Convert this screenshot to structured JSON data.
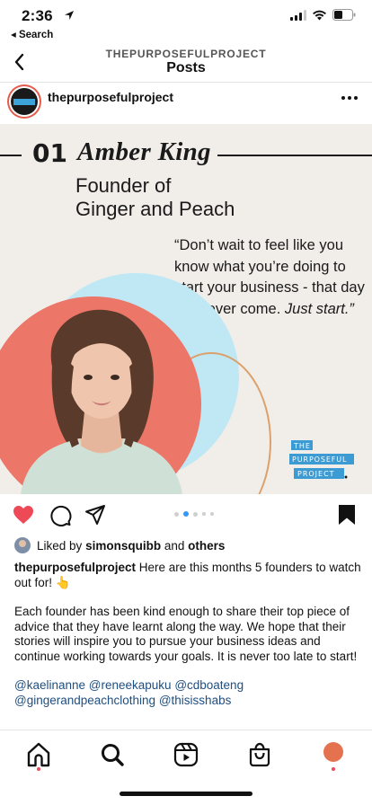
{
  "status_bar": {
    "time": "2:36",
    "back_app_label": "◂ Search"
  },
  "header": {
    "subtitle": "THEPURPOSEFULPROJECT",
    "title": "Posts"
  },
  "post": {
    "author": "thepurposefulproject",
    "image": {
      "number": "01",
      "name": "Amber King",
      "role_line1": "Founder of",
      "role_line2": "Ginger and Peach",
      "quote_main": "“Don’t wait to feel like you know what you’re doing to start your business - that day will never come.",
      "quote_emphasis": "Just start.”",
      "logo_line1": "THE",
      "logo_line2": "PURPOSEFUL",
      "logo_line3": "PROJECT",
      "colors": {
        "background": "#f1eee9",
        "red_circle": "#ec7668",
        "blue_circle": "#bfe8f4",
        "outline_circle": "#dca06c",
        "logo_blue": "#3d9bd3"
      }
    },
    "carousel": {
      "count": 5,
      "active_index": 1
    },
    "likes": {
      "prefix": "Liked by",
      "user": "simonsquibb",
      "joiner": "and",
      "others": "others"
    },
    "caption": {
      "author": "thepurposefulproject",
      "intro": "Here are this months 5 founders to watch out for! 👆",
      "body": "Each founder has been kind enough to share their top piece of advice that they have learnt along the way. We hope that their stories will inspire you to pursue your business ideas and continue working towards your goals. It is never too late to start!",
      "mentions": [
        "@kaelinanne",
        "@reneekapuku",
        "@cdboateng",
        "@gingerandpeachclothing",
        "@thisisshabs"
      ]
    }
  },
  "icons": {
    "heart": "heart-icon-filled",
    "comment": "comment-icon",
    "share": "share-icon",
    "bookmark": "bookmark-icon-filled",
    "home": "home-icon",
    "search": "search-icon",
    "reels": "reels-icon",
    "shop": "shop-icon",
    "more": "more-dots-icon"
  },
  "accent_colors": {
    "like_red": "#ed4956",
    "link_blue": "#1f4e80",
    "dot_active": "#3897f0"
  }
}
